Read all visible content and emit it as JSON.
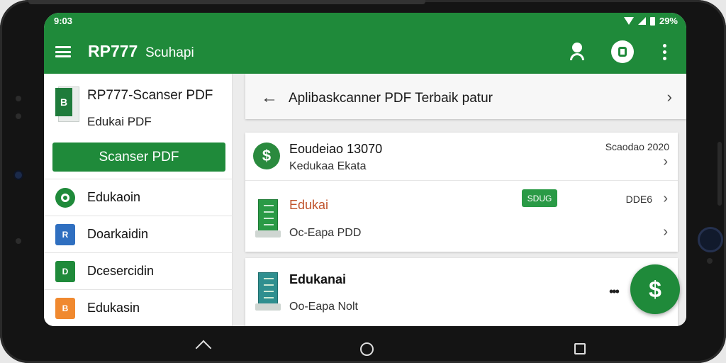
{
  "status": {
    "time": "9:03",
    "battery": "29%"
  },
  "appbar": {
    "title": "RP777",
    "subtitle": "Scuhapi"
  },
  "sidebar": {
    "app_name": "RP777-Scanser PDF",
    "app_sub": "Edukai PDF",
    "doc_icon_letter": "B",
    "scan_button": "Scanser PDF",
    "items": [
      {
        "label": "Edukaoin",
        "icon": "green-circle-icon"
      },
      {
        "label": "Doarkaidin",
        "icon_text": "R",
        "color": "#2f6fc0"
      },
      {
        "label": "Dcesercidin",
        "icon_text": "D",
        "color": "#1f8a3a"
      },
      {
        "label": "Edukasin",
        "icon_text": "B",
        "color": "#f0892f"
      }
    ]
  },
  "main": {
    "header_title": "Aplibaskcanner PDF Terbaik patur",
    "rows": [
      {
        "title": "Eoudeiao 13070",
        "sub": "Kedukaa Ekata",
        "meta": "Scaodao 2020"
      },
      {
        "title": "Edukai",
        "sub": "Oc-Eapa PDD",
        "badge": "SDUG",
        "meta": "DDE6"
      },
      {
        "title": "Edukanai",
        "sub": "Oo-Eapa Nolt"
      }
    ]
  },
  "fab": {
    "symbol": "$",
    "dots": "•••"
  },
  "colors": {
    "primary": "#1f8a3a",
    "accent_text": "#c0532b"
  }
}
